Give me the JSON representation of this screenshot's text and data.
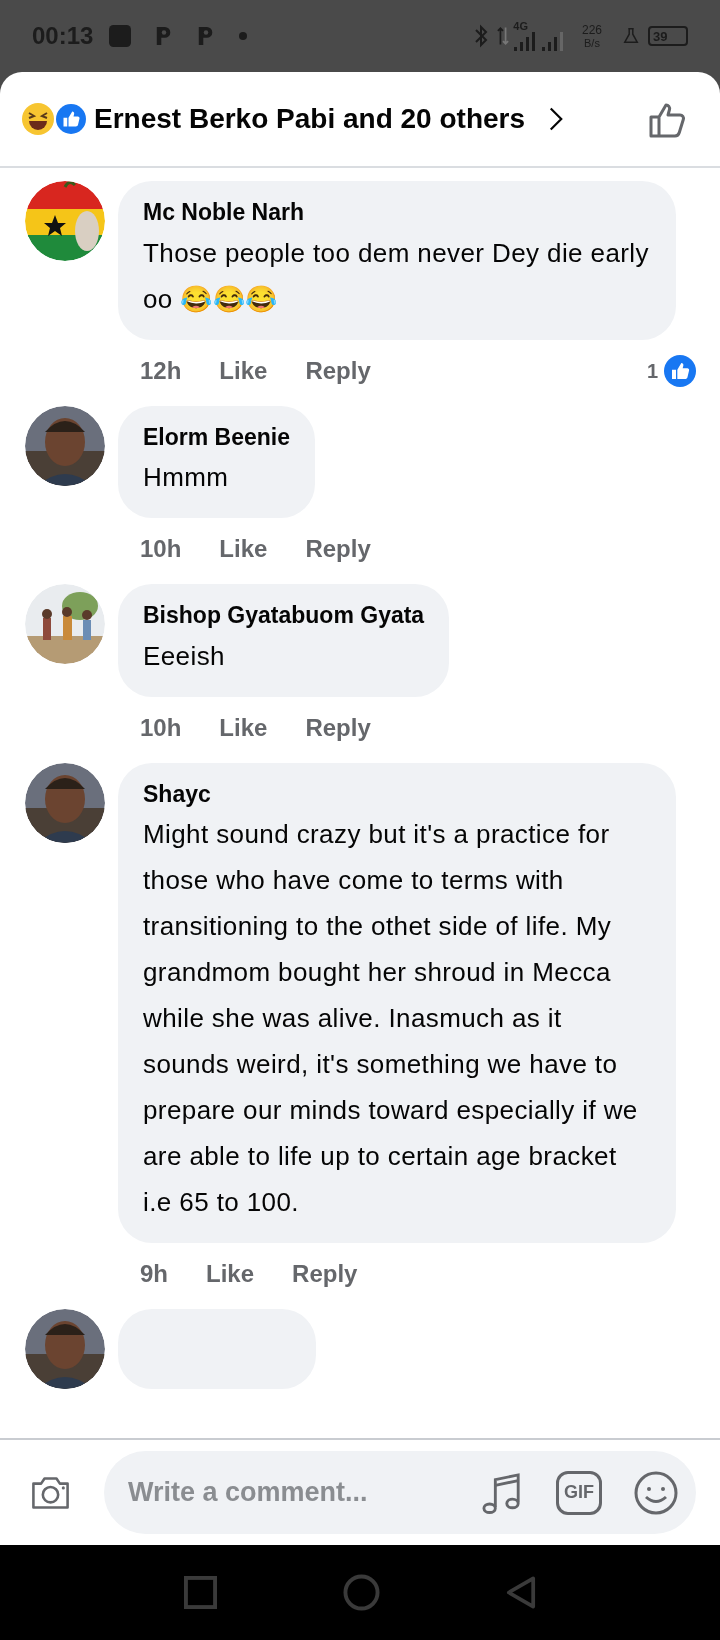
{
  "status_bar": {
    "time": "00:13",
    "network": "4G",
    "speed": "226",
    "speed_unit": "B/s",
    "battery": "39"
  },
  "header": {
    "title": "Ernest Berko Pabi and 20 others"
  },
  "comments": [
    {
      "name": "Mc Noble Narh",
      "text": "Those people too dem never Dey die early oo 😂😂😂",
      "time": "12h",
      "like": "Like",
      "reply": "Reply",
      "reaction_count": "1",
      "avatar": {
        "kind": "flag"
      }
    },
    {
      "name": "Elorm Beenie",
      "text": "Hmmm",
      "time": "10h",
      "like": "Like",
      "reply": "Reply",
      "avatar": {
        "kind": "person"
      }
    },
    {
      "name": "Bishop Gyatabuom Gyata",
      "text": "Eeeish",
      "time": "10h",
      "like": "Like",
      "reply": "Reply",
      "avatar": {
        "kind": "group"
      }
    },
    {
      "name": "Shayc",
      "text": "Might sound crazy but it's a practice for those who have come to terms with transitioning to the othet side of life. My grandmom bought her shroud in Mecca while she was alive. Inasmuch as it sounds weird, it's something we have to prepare our minds toward especially if we are able to life up to certain age bracket i.e 65 to 100.",
      "time": "9h",
      "like": "Like",
      "reply": "Reply",
      "avatar": {
        "kind": "person"
      }
    }
  ],
  "partial_comment": {
    "avatar": {
      "kind": "person"
    }
  },
  "composer": {
    "placeholder": "Write a comment...",
    "gif": "GIF"
  }
}
